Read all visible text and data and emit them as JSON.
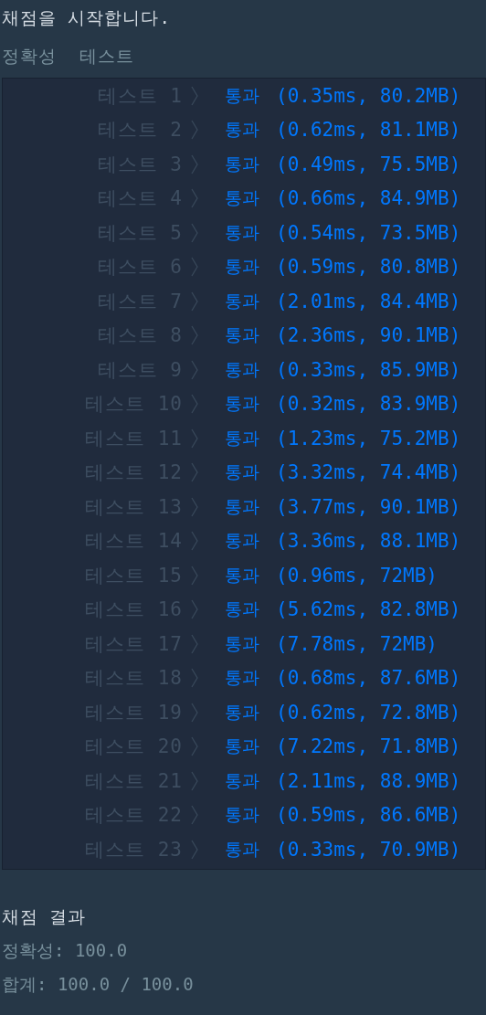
{
  "heading": "채점을 시작합니다.",
  "section_title": "정확성  테스트",
  "tests": [
    {
      "label": "테스트 1",
      "status": "통과",
      "result": "(0.35ms, 80.2MB)"
    },
    {
      "label": "테스트 2",
      "status": "통과",
      "result": "(0.62ms, 81.1MB)"
    },
    {
      "label": "테스트 3",
      "status": "통과",
      "result": "(0.49ms, 75.5MB)"
    },
    {
      "label": "테스트 4",
      "status": "통과",
      "result": "(0.66ms, 84.9MB)"
    },
    {
      "label": "테스트 5",
      "status": "통과",
      "result": "(0.54ms, 73.5MB)"
    },
    {
      "label": "테스트 6",
      "status": "통과",
      "result": "(0.59ms, 80.8MB)"
    },
    {
      "label": "테스트 7",
      "status": "통과",
      "result": "(2.01ms, 84.4MB)"
    },
    {
      "label": "테스트 8",
      "status": "통과",
      "result": "(2.36ms, 90.1MB)"
    },
    {
      "label": "테스트 9",
      "status": "통과",
      "result": "(0.33ms, 85.9MB)"
    },
    {
      "label": "테스트 10",
      "status": "통과",
      "result": "(0.32ms, 83.9MB)"
    },
    {
      "label": "테스트 11",
      "status": "통과",
      "result": "(1.23ms, 75.2MB)"
    },
    {
      "label": "테스트 12",
      "status": "통과",
      "result": "(3.32ms, 74.4MB)"
    },
    {
      "label": "테스트 13",
      "status": "통과",
      "result": "(3.77ms, 90.1MB)"
    },
    {
      "label": "테스트 14",
      "status": "통과",
      "result": "(3.36ms, 88.1MB)"
    },
    {
      "label": "테스트 15",
      "status": "통과",
      "result": "(0.96ms, 72MB)"
    },
    {
      "label": "테스트 16",
      "status": "통과",
      "result": "(5.62ms, 82.8MB)"
    },
    {
      "label": "테스트 17",
      "status": "통과",
      "result": "(7.78ms, 72MB)"
    },
    {
      "label": "테스트 18",
      "status": "통과",
      "result": "(0.68ms, 87.6MB)"
    },
    {
      "label": "테스트 19",
      "status": "통과",
      "result": "(0.62ms, 72.8MB)"
    },
    {
      "label": "테스트 20",
      "status": "통과",
      "result": "(7.22ms, 71.8MB)"
    },
    {
      "label": "테스트 21",
      "status": "통과",
      "result": "(2.11ms, 88.9MB)"
    },
    {
      "label": "테스트 22",
      "status": "통과",
      "result": "(0.59ms, 86.6MB)"
    },
    {
      "label": "테스트 23",
      "status": "통과",
      "result": "(0.33ms, 70.9MB)"
    }
  ],
  "summary": {
    "title": "채점 결과",
    "lines": [
      "정확성: 100.0",
      "합계: 100.0 / 100.0"
    ]
  }
}
